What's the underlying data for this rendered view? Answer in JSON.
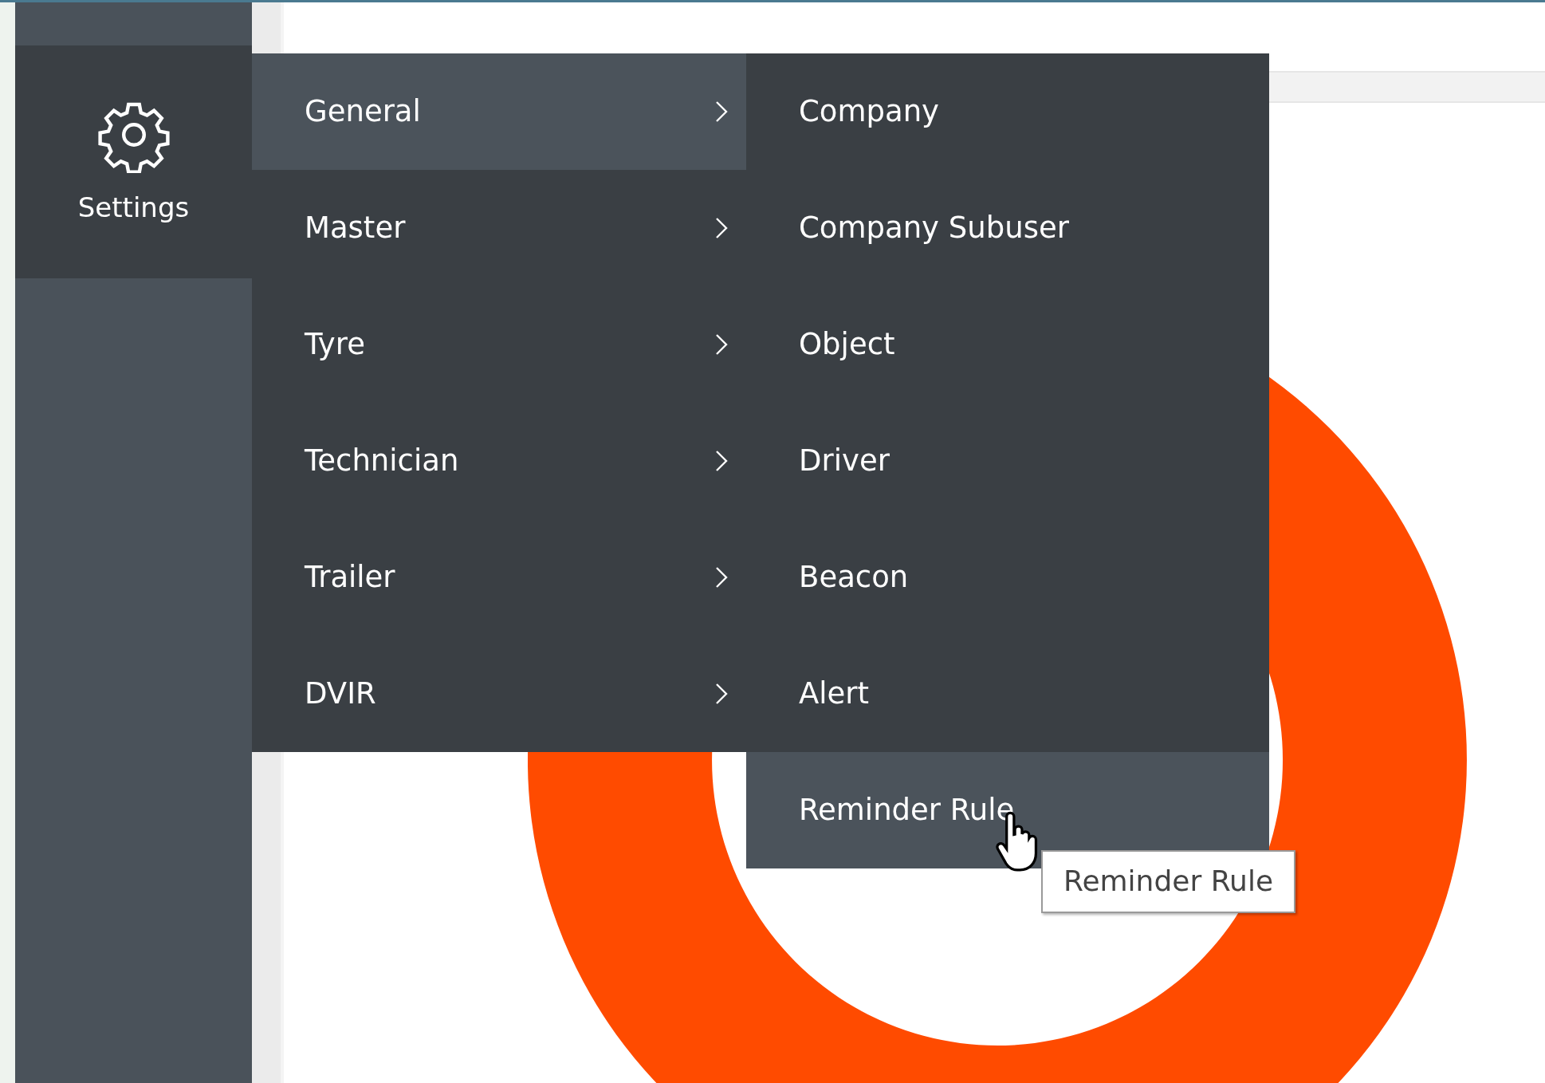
{
  "sidebar": {
    "items": [
      {
        "label": "Settings",
        "selected": true
      }
    ]
  },
  "menu": {
    "items": [
      {
        "label": "General",
        "selected": true
      },
      {
        "label": "Master",
        "selected": false
      },
      {
        "label": "Tyre",
        "selected": false
      },
      {
        "label": "Technician",
        "selected": false
      },
      {
        "label": "Trailer",
        "selected": false
      },
      {
        "label": "DVIR",
        "selected": false
      }
    ]
  },
  "submenu": {
    "items": [
      {
        "label": "Company",
        "selected": false
      },
      {
        "label": "Company Subuser",
        "selected": false
      },
      {
        "label": "Object",
        "selected": false
      },
      {
        "label": "Driver",
        "selected": false
      },
      {
        "label": "Beacon",
        "selected": false
      },
      {
        "label": "Alert",
        "selected": false
      },
      {
        "label": "Reminder Rule",
        "selected": true
      }
    ]
  },
  "tooltip": {
    "text": "Reminder Rule"
  }
}
